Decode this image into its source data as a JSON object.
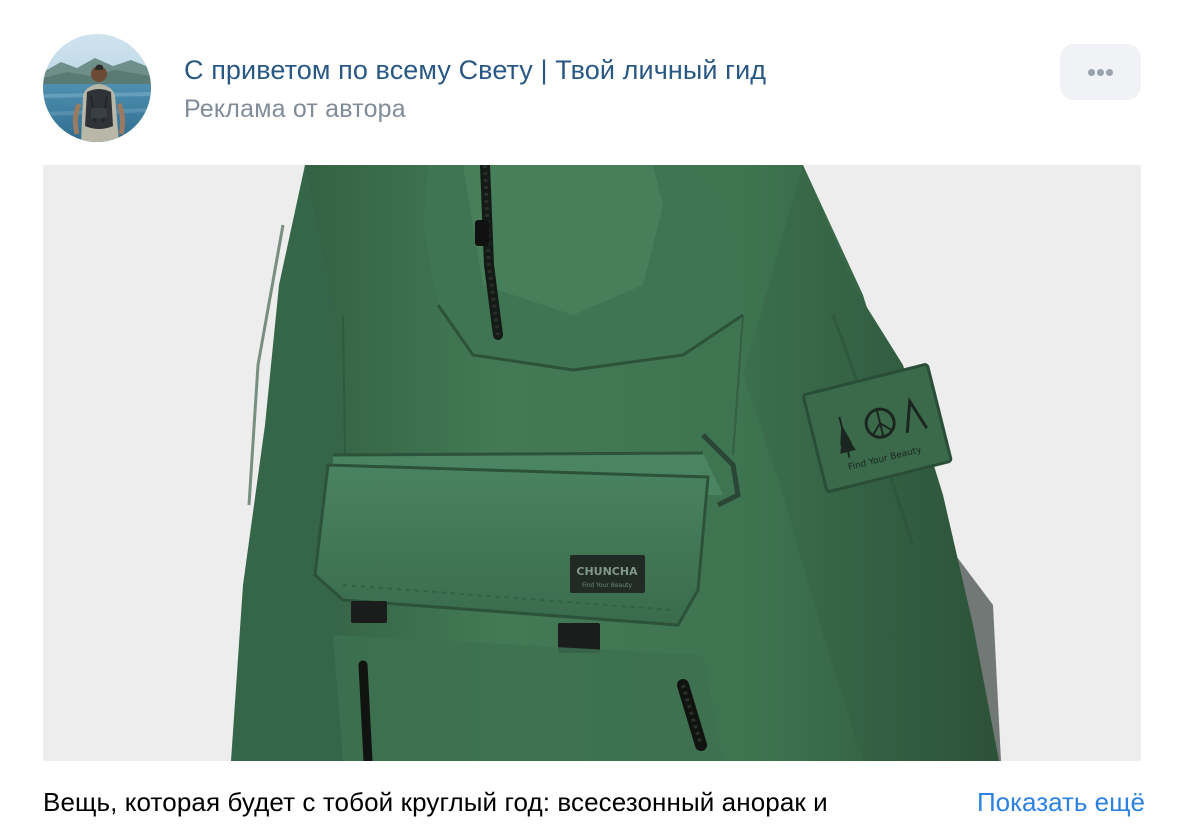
{
  "post": {
    "author_name": "С приветом по всему Свету | Твой личный гид",
    "subtitle": "Реклама от автора",
    "text": "Вещь, которая будет с тобой круглый год: всесезонный анорак и",
    "show_more_label": "Показать ещё",
    "more_icon": "more-horizontal-icon"
  },
  "photo": {
    "brand_label": "CHUNCHA",
    "brand_sublabel": "Find Your Beauty",
    "sleeve_patch_label": "Find Your Beauty"
  },
  "colors": {
    "link": "#2a5885",
    "accent_link": "#2d81e0",
    "secondary_text": "#818c99",
    "jacket_green": "#3d6e4e",
    "photo_background": "#ededed"
  }
}
